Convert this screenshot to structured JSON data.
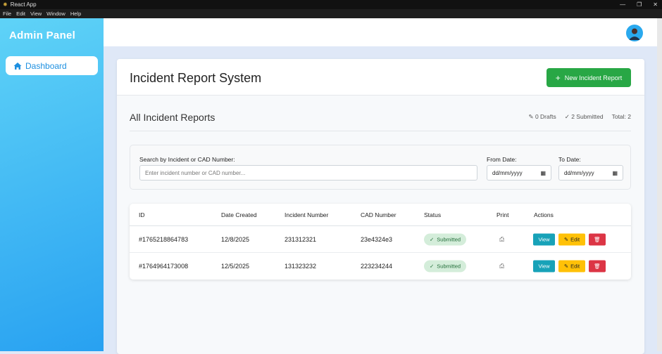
{
  "window": {
    "title": "React App",
    "menu": [
      "File",
      "Edit",
      "View",
      "Window",
      "Help"
    ]
  },
  "sidebar": {
    "brand": "Admin Panel",
    "items": [
      {
        "label": "Dashboard",
        "icon": "home-icon"
      }
    ]
  },
  "page": {
    "title": "Incident Report System",
    "new_button": "New Incident Report",
    "section_title": "All Incident Reports",
    "stats": {
      "drafts": "0 Drafts",
      "submitted": "2 Submitted",
      "total": "Total: 2"
    }
  },
  "filters": {
    "search_label": "Search by Incident or CAD Number:",
    "search_placeholder": "Enter incident number or CAD number...",
    "from_label": "From Date:",
    "from_value": "dd/mm/yyyy",
    "to_label": "To Date:",
    "to_value": "dd/mm/yyyy"
  },
  "table": {
    "headers": [
      "ID",
      "Date Created",
      "Incident Number",
      "CAD Number",
      "Status",
      "Print",
      "Actions"
    ],
    "rows": [
      {
        "id": "#1765218864783",
        "date": "12/8/2025",
        "incident": "231312321",
        "cad": "23e4324e3",
        "status": "Submitted"
      },
      {
        "id": "#1764964173008",
        "date": "12/5/2025",
        "incident": "131323232",
        "cad": "223234244",
        "status": "Submitted"
      }
    ],
    "actions": {
      "view": "View",
      "edit": "Edit"
    }
  },
  "colors": {
    "primary": "#28a745",
    "info": "#17a2b8",
    "warning": "#ffc107",
    "danger": "#dc3545",
    "sidebar": "#28a1f1"
  }
}
